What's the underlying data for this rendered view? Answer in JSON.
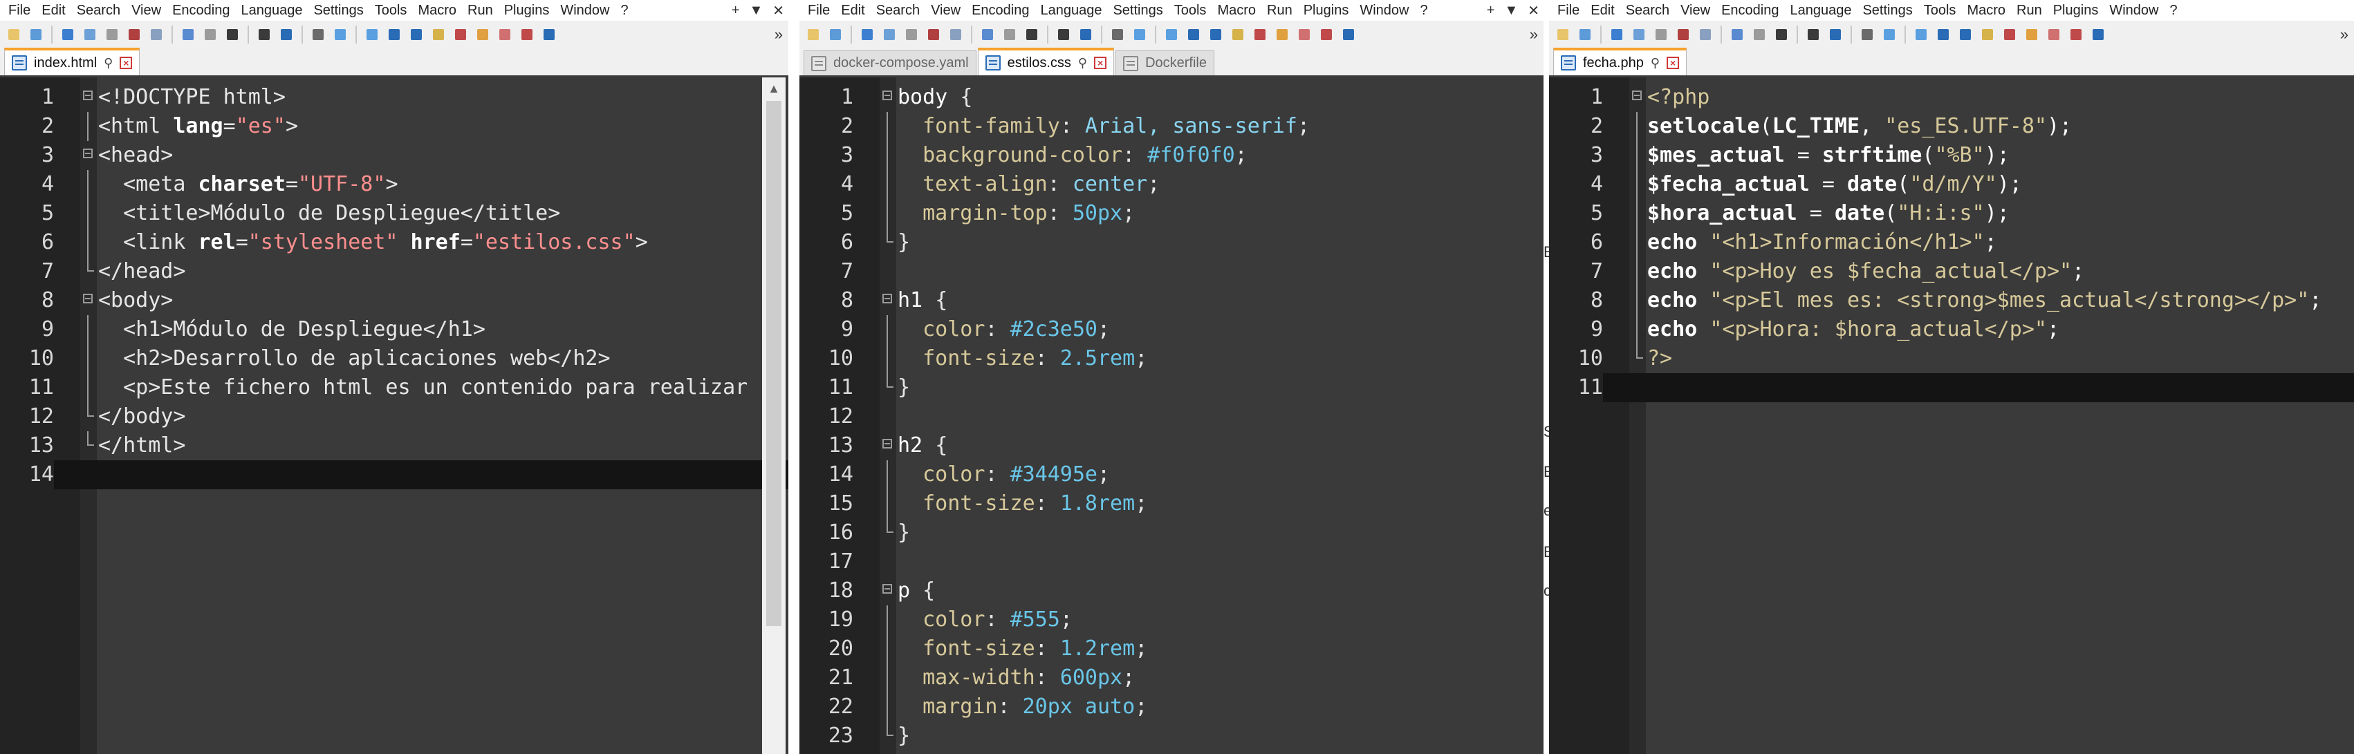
{
  "menu": [
    "File",
    "Edit",
    "Search",
    "View",
    "Encoding",
    "Language",
    "Settings",
    "Tools",
    "Macro",
    "Run",
    "Plugins",
    "Window",
    "?"
  ],
  "window_controls": [
    "+",
    "▼",
    "✕"
  ],
  "toolbar_overflow": "»",
  "colors": {
    "editor_bg": "#3a3a3a",
    "gutter_bg": "#232323",
    "current_line": "#141414",
    "active_tab_accent": "#f7a12b"
  },
  "windows": [
    {
      "id": "left",
      "tabs": [
        {
          "label": "index.html",
          "active": true,
          "icon": "document-icon"
        }
      ],
      "current_line": 14,
      "lines": [
        {
          "n": "1",
          "tokens": [
            {
              "t": "tag",
              "v": "<!DOCTYPE html>"
            }
          ],
          "fold": "box"
        },
        {
          "n": "2",
          "tokens": [
            {
              "t": "tag",
              "v": "<html "
            },
            {
              "t": "attr",
              "v": "lang"
            },
            {
              "t": "tag",
              "v": "="
            },
            {
              "t": "str",
              "v": "\"es\""
            },
            {
              "t": "tag",
              "v": ">"
            }
          ],
          "fold": "vline"
        },
        {
          "n": "3",
          "tokens": [
            {
              "t": "tag",
              "v": "<head>"
            }
          ],
          "fold": "box"
        },
        {
          "n": "4",
          "tokens": [
            {
              "t": "tag",
              "v": "  <meta "
            },
            {
              "t": "attr",
              "v": "charset"
            },
            {
              "t": "tag",
              "v": "="
            },
            {
              "t": "str",
              "v": "\"UTF-8\""
            },
            {
              "t": "tag",
              "v": ">"
            }
          ],
          "fold": "vline"
        },
        {
          "n": "5",
          "tokens": [
            {
              "t": "tag",
              "v": "  <title>Módulo de Despliegue</title>"
            }
          ],
          "fold": "vline"
        },
        {
          "n": "6",
          "tokens": [
            {
              "t": "tag",
              "v": "  <link "
            },
            {
              "t": "attr",
              "v": "rel"
            },
            {
              "t": "tag",
              "v": "="
            },
            {
              "t": "str",
              "v": "\"stylesheet\""
            },
            {
              "t": "tag",
              "v": " "
            },
            {
              "t": "attr",
              "v": "href"
            },
            {
              "t": "tag",
              "v": "="
            },
            {
              "t": "str",
              "v": "\"estilos.css\""
            },
            {
              "t": "tag",
              "v": ">"
            }
          ],
          "fold": "vline"
        },
        {
          "n": "7",
          "tokens": [
            {
              "t": "tag",
              "v": "</head>"
            }
          ],
          "fold": "end"
        },
        {
          "n": "8",
          "tokens": [
            {
              "t": "tag",
              "v": "<body>"
            }
          ],
          "fold": "box"
        },
        {
          "n": "9",
          "tokens": [
            {
              "t": "tag",
              "v": "  <h1>Módulo de Despliegue</h1>"
            }
          ],
          "fold": "vline"
        },
        {
          "n": "10",
          "tokens": [
            {
              "t": "tag",
              "v": "  <h2>Desarrollo de aplicaciones web</h2>"
            }
          ],
          "fold": "vline"
        },
        {
          "n": "11",
          "tokens": [
            {
              "t": "tag",
              "v": "  <p>Este fichero html es un contenido para realizar"
            }
          ],
          "fold": "vline"
        },
        {
          "n": "12",
          "tokens": [
            {
              "t": "tag",
              "v": "</body>"
            }
          ],
          "fold": "end"
        },
        {
          "n": "13",
          "tokens": [
            {
              "t": "tag",
              "v": "</html>"
            }
          ],
          "fold": "end"
        },
        {
          "n": "14",
          "tokens": [],
          "fold": ""
        }
      ]
    },
    {
      "id": "middle",
      "tabs": [
        {
          "label": "docker-compose.yaml",
          "active": false,
          "icon": "document-icon"
        },
        {
          "label": "estilos.css",
          "active": true,
          "icon": "document-icon"
        },
        {
          "label": "Dockerfile",
          "active": false,
          "icon": "document-icon"
        }
      ],
      "current_line": 0,
      "lines": [
        {
          "n": "1",
          "tokens": [
            {
              "t": "sel",
              "v": "body "
            },
            {
              "t": "tag",
              "v": "{"
            }
          ],
          "fold": "box"
        },
        {
          "n": "2",
          "tokens": [
            {
              "t": "prop",
              "v": "  font-family"
            },
            {
              "t": "tag",
              "v": ": "
            },
            {
              "t": "val",
              "v": "Arial, sans-serif"
            },
            {
              "t": "tag",
              "v": ";"
            }
          ],
          "fold": "vline"
        },
        {
          "n": "3",
          "tokens": [
            {
              "t": "prop",
              "v": "  background-color"
            },
            {
              "t": "tag",
              "v": ": "
            },
            {
              "t": "num",
              "v": "#f0f0f0"
            },
            {
              "t": "tag",
              "v": ";"
            }
          ],
          "fold": "vline"
        },
        {
          "n": "4",
          "tokens": [
            {
              "t": "prop",
              "v": "  text-align"
            },
            {
              "t": "tag",
              "v": ": "
            },
            {
              "t": "val",
              "v": "center"
            },
            {
              "t": "tag",
              "v": ";"
            }
          ],
          "fold": "vline"
        },
        {
          "n": "5",
          "tokens": [
            {
              "t": "prop",
              "v": "  margin-top"
            },
            {
              "t": "tag",
              "v": ": "
            },
            {
              "t": "num",
              "v": "50px"
            },
            {
              "t": "tag",
              "v": ";"
            }
          ],
          "fold": "vline"
        },
        {
          "n": "6",
          "tokens": [
            {
              "t": "tag",
              "v": "}"
            }
          ],
          "fold": "end"
        },
        {
          "n": "7",
          "tokens": [],
          "fold": ""
        },
        {
          "n": "8",
          "tokens": [
            {
              "t": "sel",
              "v": "h1 "
            },
            {
              "t": "tag",
              "v": "{"
            }
          ],
          "fold": "box"
        },
        {
          "n": "9",
          "tokens": [
            {
              "t": "prop",
              "v": "  color"
            },
            {
              "t": "tag",
              "v": ": "
            },
            {
              "t": "num",
              "v": "#2c3e50"
            },
            {
              "t": "tag",
              "v": ";"
            }
          ],
          "fold": "vline"
        },
        {
          "n": "10",
          "tokens": [
            {
              "t": "prop",
              "v": "  font-size"
            },
            {
              "t": "tag",
              "v": ": "
            },
            {
              "t": "num",
              "v": "2.5rem"
            },
            {
              "t": "tag",
              "v": ";"
            }
          ],
          "fold": "vline"
        },
        {
          "n": "11",
          "tokens": [
            {
              "t": "tag",
              "v": "}"
            }
          ],
          "fold": "end"
        },
        {
          "n": "12",
          "tokens": [],
          "fold": ""
        },
        {
          "n": "13",
          "tokens": [
            {
              "t": "sel",
              "v": "h2 "
            },
            {
              "t": "tag",
              "v": "{"
            }
          ],
          "fold": "box"
        },
        {
          "n": "14",
          "tokens": [
            {
              "t": "prop",
              "v": "  color"
            },
            {
              "t": "tag",
              "v": ": "
            },
            {
              "t": "num",
              "v": "#34495e"
            },
            {
              "t": "tag",
              "v": ";"
            }
          ],
          "fold": "vline"
        },
        {
          "n": "15",
          "tokens": [
            {
              "t": "prop",
              "v": "  font-size"
            },
            {
              "t": "tag",
              "v": ": "
            },
            {
              "t": "num",
              "v": "1.8rem"
            },
            {
              "t": "tag",
              "v": ";"
            }
          ],
          "fold": "vline"
        },
        {
          "n": "16",
          "tokens": [
            {
              "t": "tag",
              "v": "}"
            }
          ],
          "fold": "end"
        },
        {
          "n": "17",
          "tokens": [],
          "fold": ""
        },
        {
          "n": "18",
          "tokens": [
            {
              "t": "sel",
              "v": "p "
            },
            {
              "t": "tag",
              "v": "{"
            }
          ],
          "fold": "box"
        },
        {
          "n": "19",
          "tokens": [
            {
              "t": "prop",
              "v": "  color"
            },
            {
              "t": "tag",
              "v": ": "
            },
            {
              "t": "num",
              "v": "#555"
            },
            {
              "t": "tag",
              "v": ";"
            }
          ],
          "fold": "vline"
        },
        {
          "n": "20",
          "tokens": [
            {
              "t": "prop",
              "v": "  font-size"
            },
            {
              "t": "tag",
              "v": ": "
            },
            {
              "t": "num",
              "v": "1.2rem"
            },
            {
              "t": "tag",
              "v": ";"
            }
          ],
          "fold": "vline"
        },
        {
          "n": "21",
          "tokens": [
            {
              "t": "prop",
              "v": "  max-width"
            },
            {
              "t": "tag",
              "v": ": "
            },
            {
              "t": "num",
              "v": "600px"
            },
            {
              "t": "tag",
              "v": ";"
            }
          ],
          "fold": "vline"
        },
        {
          "n": "22",
          "tokens": [
            {
              "t": "prop",
              "v": "  margin"
            },
            {
              "t": "tag",
              "v": ": "
            },
            {
              "t": "num",
              "v": "20px auto"
            },
            {
              "t": "tag",
              "v": ";"
            }
          ],
          "fold": "vline"
        },
        {
          "n": "23",
          "tokens": [
            {
              "t": "tag",
              "v": "}"
            }
          ],
          "fold": "end"
        }
      ]
    },
    {
      "id": "right",
      "tabs": [
        {
          "label": "fecha.php",
          "active": true,
          "icon": "document-icon"
        }
      ],
      "current_line": 11,
      "lines": [
        {
          "n": "1",
          "tokens": [
            {
              "t": "php-delim",
              "v": "<?php"
            }
          ],
          "fold": "box"
        },
        {
          "n": "2",
          "tokens": [
            {
              "t": "php-kw",
              "v": "setlocale"
            },
            {
              "t": "php-paren",
              "v": "("
            },
            {
              "t": "php-kw",
              "v": "LC_TIME"
            },
            {
              "t": "php-paren",
              "v": ", "
            },
            {
              "t": "php-str",
              "v": "\"es_ES.UTF-8\""
            },
            {
              "t": "php-paren",
              "v": ");"
            }
          ],
          "fold": "vline"
        },
        {
          "n": "3",
          "tokens": [
            {
              "t": "php-var",
              "v": "$mes_actual"
            },
            {
              "t": "php-paren",
              "v": " = "
            },
            {
              "t": "php-kw",
              "v": "strftime"
            },
            {
              "t": "php-paren",
              "v": "("
            },
            {
              "t": "php-str",
              "v": "\"%B\""
            },
            {
              "t": "php-paren",
              "v": ");"
            }
          ],
          "fold": "vline"
        },
        {
          "n": "4",
          "tokens": [
            {
              "t": "php-var",
              "v": "$fecha_actual"
            },
            {
              "t": "php-paren",
              "v": " = "
            },
            {
              "t": "php-kw",
              "v": "date"
            },
            {
              "t": "php-paren",
              "v": "("
            },
            {
              "t": "php-str",
              "v": "\"d/m/Y\""
            },
            {
              "t": "php-paren",
              "v": ");"
            }
          ],
          "fold": "vline"
        },
        {
          "n": "5",
          "tokens": [
            {
              "t": "php-var",
              "v": "$hora_actual"
            },
            {
              "t": "php-paren",
              "v": " = "
            },
            {
              "t": "php-kw",
              "v": "date"
            },
            {
              "t": "php-paren",
              "v": "("
            },
            {
              "t": "php-str",
              "v": "\"H:i:s\""
            },
            {
              "t": "php-paren",
              "v": ");"
            }
          ],
          "fold": "vline"
        },
        {
          "n": "6",
          "tokens": [
            {
              "t": "php-kw",
              "v": "echo"
            },
            {
              "t": "php-paren",
              "v": " "
            },
            {
              "t": "php-str",
              "v": "\"<h1>Información</h1>\""
            },
            {
              "t": "php-paren",
              "v": ";"
            }
          ],
          "fold": "vline"
        },
        {
          "n": "7",
          "tokens": [
            {
              "t": "php-kw",
              "v": "echo"
            },
            {
              "t": "php-paren",
              "v": " "
            },
            {
              "t": "php-str",
              "v": "\"<p>Hoy es $fecha_actual</p>\""
            },
            {
              "t": "php-paren",
              "v": ";"
            }
          ],
          "fold": "vline"
        },
        {
          "n": "8",
          "tokens": [
            {
              "t": "php-kw",
              "v": "echo"
            },
            {
              "t": "php-paren",
              "v": " "
            },
            {
              "t": "php-str",
              "v": "\"<p>El mes es: <strong>$mes_actual</strong></p>\""
            },
            {
              "t": "php-paren",
              "v": ";"
            }
          ],
          "fold": "vline"
        },
        {
          "n": "9",
          "tokens": [
            {
              "t": "php-kw",
              "v": "echo"
            },
            {
              "t": "php-paren",
              "v": " "
            },
            {
              "t": "php-str",
              "v": "\"<p>Hora: $hora_actual</p>\""
            },
            {
              "t": "php-paren",
              "v": ";"
            }
          ],
          "fold": "vline"
        },
        {
          "n": "10",
          "tokens": [
            {
              "t": "php-delim",
              "v": "?>"
            }
          ],
          "fold": "end"
        },
        {
          "n": "11",
          "tokens": [],
          "fold": ""
        }
      ]
    }
  ],
  "background_window_glyphs": [
    "E",
    "S",
    "E",
    "e",
    "E",
    "c"
  ]
}
